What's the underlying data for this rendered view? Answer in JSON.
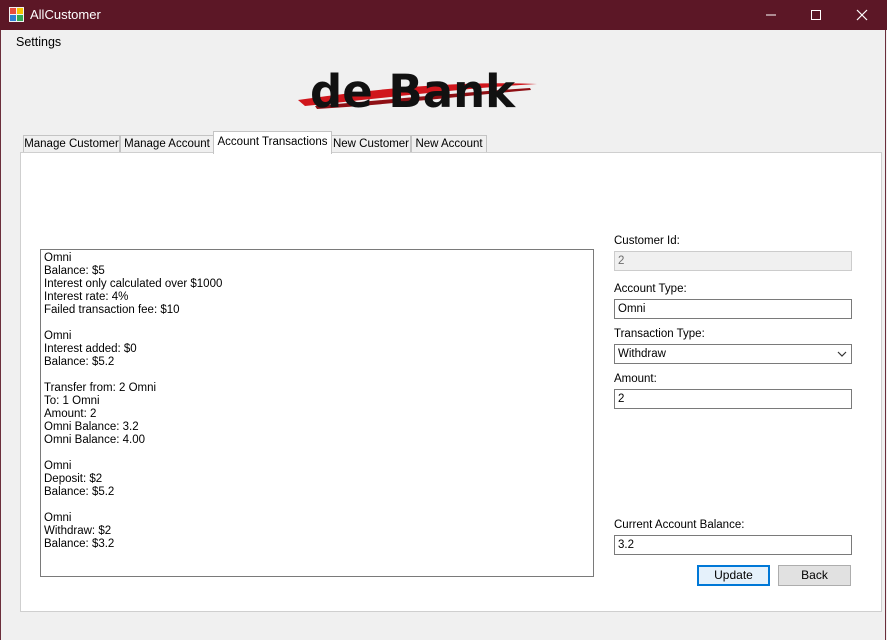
{
  "window": {
    "title": "AllCustomer"
  },
  "menu": {
    "settings": "Settings"
  },
  "tabs": [
    {
      "label": "Manage Customer"
    },
    {
      "label": "Manage Account"
    },
    {
      "label": "Account Transactions"
    },
    {
      "label": "New Customer"
    },
    {
      "label": "New Account"
    }
  ],
  "active_tab": "Account Transactions",
  "logo": {
    "text": "de Bank"
  },
  "transactions_log": [
    "Omni",
    "Balance: $5",
    "Interest only calculated over $1000",
    "Interest rate: 4%",
    "Failed transaction fee: $10",
    "",
    "Omni",
    "Interest added: $0",
    "Balance: $5.2",
    "",
    "Transfer from: 2 Omni",
    "To: 1 Omni",
    "Amount: 2",
    "Omni Balance: 3.2",
    "Omni Balance: 4.00",
    "",
    "Omni",
    "Deposit: $2",
    "Balance: $5.2",
    "",
    "Omni",
    "Withdraw: $2",
    "Balance: $3.2"
  ],
  "form": {
    "customer_id_label": "Customer Id:",
    "customer_id_value": "2",
    "account_type_label": "Account Type:",
    "account_type_value": "Omni",
    "transaction_type_label": "Transaction Type:",
    "transaction_type_value": "Withdraw",
    "amount_label": "Amount:",
    "amount_value": "2",
    "current_balance_label": "Current Account Balance:",
    "current_balance_value": "3.2"
  },
  "buttons": {
    "update": "Update",
    "back": "Back"
  },
  "colors": {
    "titlebar": "#5c1726",
    "logo_swoosh": "#d0161c",
    "focus_border": "#0078d7"
  }
}
